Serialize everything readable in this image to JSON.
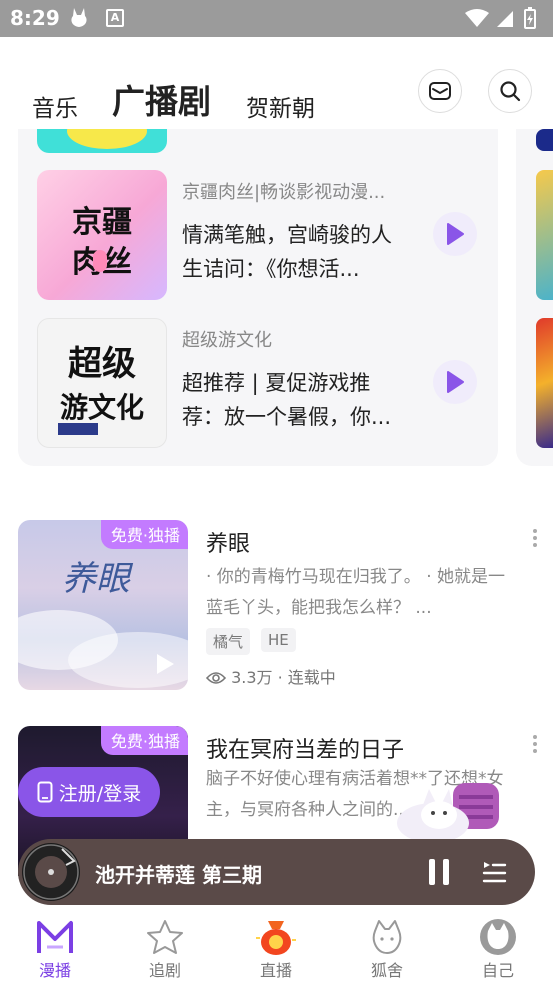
{
  "status_bar": {
    "time": "8:29"
  },
  "top_nav": {
    "tabs": [
      {
        "label": "音乐",
        "active": false
      },
      {
        "label": "广播剧",
        "active": true
      },
      {
        "label": "贺新朝",
        "active": false
      }
    ]
  },
  "recommend": {
    "cut_item_text": "...",
    "items": [
      {
        "cover_text_top": "京疆",
        "cover_text_bottom": "肉丝",
        "subtitle": "京疆肉丝|畅谈影视动漫...",
        "title": "情满笔触，宫崎骏的人生诘问：《你想活..."
      },
      {
        "cover_text_top": "超级",
        "cover_text_bottom": "游文化",
        "subtitle": "超级游文化",
        "title": "超推荐 | 夏促游戏推荐：放一个暑假，你..."
      }
    ]
  },
  "dramas": [
    {
      "badge": "免费·独播",
      "title": "养眼",
      "desc": "· 你的青梅竹马现在归我了。   · 她就是一蓝毛丫头，能把我怎么样？ ...",
      "tags": [
        "橘气",
        "HE"
      ],
      "stats": "3.3万 · 连载中"
    },
    {
      "badge": "免费·独播",
      "title": "我在冥府当差的日子",
      "desc": "脑子不好使心理有病活着想**了还想*女主，与冥府各种人之间的...",
      "tags": [],
      "stats": ""
    }
  ],
  "login_button": {
    "label": "注册/登录"
  },
  "player": {
    "title": "池开并蒂莲 第三期"
  },
  "bottom_nav": {
    "items": [
      {
        "label": "漫播",
        "active": true
      },
      {
        "label": "追剧",
        "active": false
      },
      {
        "label": "直播",
        "active": false
      },
      {
        "label": "狐舍",
        "active": false
      },
      {
        "label": "自己",
        "active": false
      }
    ]
  },
  "colors": {
    "accent": "#7b3fe4",
    "login_bg": "#8a55e8",
    "badge_bg": "#c37bff",
    "player_bg": "#5a4a48",
    "status_bar": "#9b9b9b"
  }
}
